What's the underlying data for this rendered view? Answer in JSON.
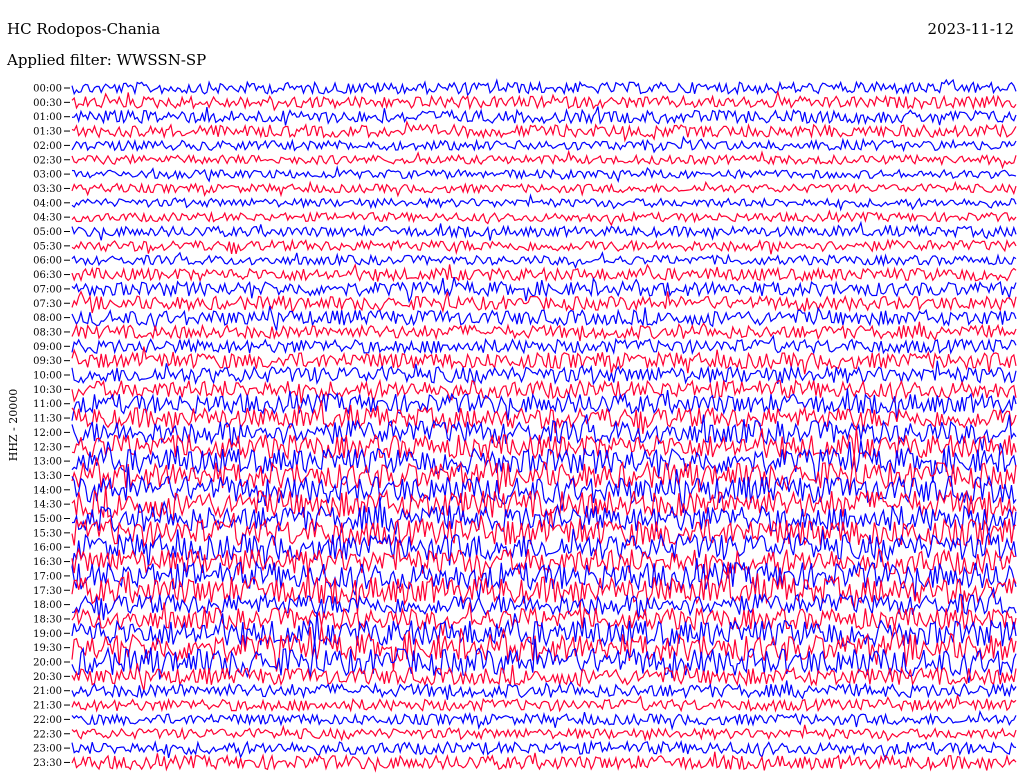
{
  "header": {
    "station": "HC Rodopos-Chania",
    "date": "2023-11-12",
    "filter": "Applied filter: WWSSN-SP",
    "channel_label": "HHZ - 20000"
  },
  "chart_data": {
    "type": "line",
    "title": "HC Rodopos-Chania",
    "subtitle": "Applied filter: WWSSN-SP",
    "ylabel": "HHZ - 20000",
    "xlabel": "",
    "trace_colors": [
      "#0000ff",
      "#ff0033"
    ],
    "categories": [
      "00:00",
      "00:30",
      "01:00",
      "01:30",
      "02:00",
      "02:30",
      "03:00",
      "03:30",
      "04:00",
      "04:30",
      "05:00",
      "05:30",
      "06:00",
      "06:30",
      "07:00",
      "07:30",
      "08:00",
      "08:30",
      "09:00",
      "09:30",
      "10:00",
      "10:30",
      "11:00",
      "11:30",
      "12:00",
      "12:30",
      "13:00",
      "13:30",
      "14:00",
      "14:30",
      "15:00",
      "15:30",
      "16:00",
      "16:30",
      "17:00",
      "17:30",
      "18:00",
      "18:30",
      "19:00",
      "19:30",
      "20:00",
      "20:30",
      "21:00",
      "21:30",
      "22:00",
      "22:30",
      "23:00",
      "23:30"
    ],
    "activity": [
      0.3,
      0.32,
      0.36,
      0.34,
      0.22,
      0.18,
      0.16,
      0.16,
      0.16,
      0.18,
      0.24,
      0.26,
      0.2,
      0.34,
      0.42,
      0.4,
      0.46,
      0.38,
      0.4,
      0.5,
      0.52,
      0.58,
      0.66,
      0.72,
      0.82,
      0.85,
      0.92,
      0.95,
      1.0,
      1.0,
      0.95,
      1.0,
      0.95,
      0.92,
      1.0,
      1.0,
      0.7,
      0.74,
      0.95,
      1.0,
      1.0,
      0.55,
      0.38,
      0.3,
      0.26,
      0.24,
      0.34,
      0.4
    ]
  }
}
